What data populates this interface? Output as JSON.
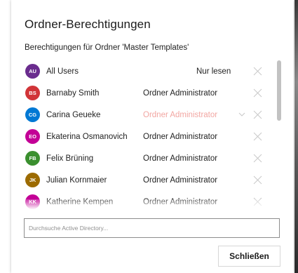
{
  "dialog": {
    "title": "Ordner-Berechtigungen",
    "subtitle": "Berechtigungen für Ordner 'Master Templates'"
  },
  "members": [
    {
      "initials": "AU",
      "name": "All Users",
      "role": "Nur lesen",
      "avatar_color": "#6a2c8e",
      "role_style": "readonly"
    },
    {
      "initials": "BS",
      "name": "Barnaby Smith",
      "role": "Ordner Administrator",
      "avatar_color": "#d13438",
      "role_style": "normal"
    },
    {
      "initials": "CG",
      "name": "Carina Geueke",
      "role": "Ordner Administrator",
      "avatar_color": "#0078d4",
      "role_style": "dim-dropdown"
    },
    {
      "initials": "EO",
      "name": "Ekaterina Osmanovich",
      "role": "Ordner Administrator",
      "avatar_color": "#c30096",
      "role_style": "normal"
    },
    {
      "initials": "FB",
      "name": "Felix Brüning",
      "role": "Ordner Administrator",
      "avatar_color": "#3a8f2e",
      "role_style": "normal"
    },
    {
      "initials": "JK",
      "name": "Julian Kornmaier",
      "role": "Ordner Administrator",
      "avatar_color": "#9c6b00",
      "role_style": "normal"
    },
    {
      "initials": "KK",
      "name": "Katherine Kempen",
      "role": "Ordner Administrator",
      "avatar_color": "#c30096",
      "role_style": "normal"
    }
  ],
  "search": {
    "placeholder": "Durchsuche Active Directory..."
  },
  "footer": {
    "close_label": "Schließen"
  },
  "icons": {
    "remove": "close-icon",
    "dropdown": "chevron-down-icon"
  }
}
